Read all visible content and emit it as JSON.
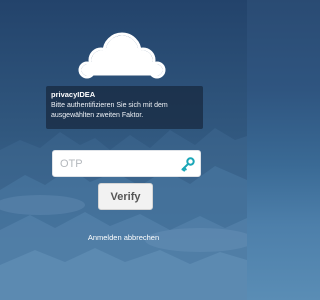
{
  "brand": {
    "logo_icon": "cloud-logo-icon",
    "background_color": "#2f5580"
  },
  "info": {
    "title": "privacyIDEA",
    "message": "Bitte authentifizieren Sie sich mit dem ausgewählten zweiten Faktor."
  },
  "form": {
    "otp_placeholder": "OTP",
    "otp_value": "",
    "key_icon": "key-icon",
    "key_icon_color": "#1aa6b7",
    "verify_label": "Verify"
  },
  "cancel_label": "Anmelden abbrechen"
}
